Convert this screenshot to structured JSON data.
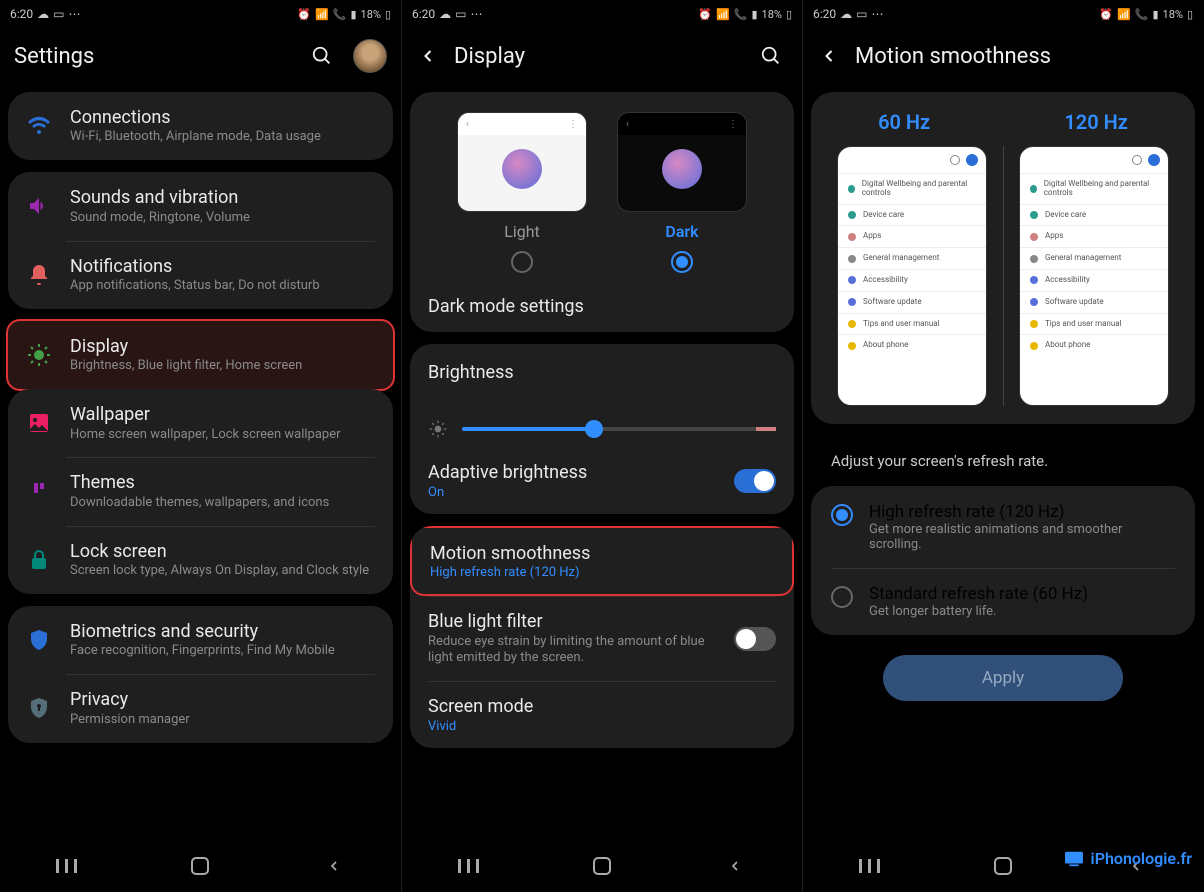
{
  "status": {
    "time": "6:20",
    "battery": "18%"
  },
  "panel1": {
    "title": "Settings",
    "groups": [
      {
        "items": [
          {
            "icon": "wifi",
            "label": "Connections",
            "sub": "Wi-Fi, Bluetooth, Airplane mode, Data usage"
          }
        ]
      },
      {
        "items": [
          {
            "icon": "sound",
            "label": "Sounds and vibration",
            "sub": "Sound mode, Ringtone, Volume"
          },
          {
            "icon": "bell",
            "label": "Notifications",
            "sub": "App notifications, Status bar, Do not disturb"
          }
        ]
      },
      {
        "highlight": true,
        "items": [
          {
            "icon": "brightness",
            "label": "Display",
            "sub": "Brightness, Blue light filter, Home screen"
          }
        ]
      },
      {
        "items": [
          {
            "icon": "image",
            "label": "Wallpaper",
            "sub": "Home screen wallpaper, Lock screen wallpaper"
          },
          {
            "icon": "palette",
            "label": "Themes",
            "sub": "Downloadable themes, wallpapers, and icons"
          },
          {
            "icon": "lock",
            "label": "Lock screen",
            "sub": "Screen lock type, Always On Display, and Clock style"
          }
        ]
      },
      {
        "items": [
          {
            "icon": "shield",
            "label": "Biometrics and security",
            "sub": "Face recognition, Fingerprints, Find My Mobile"
          },
          {
            "icon": "privacy",
            "label": "Privacy",
            "sub": "Permission manager"
          }
        ]
      }
    ]
  },
  "panel2": {
    "title": "Display",
    "theme": {
      "light": "Light",
      "dark": "Dark",
      "selected": "dark"
    },
    "dark_mode": "Dark mode settings",
    "brightness": {
      "label": "Brightness",
      "value": 42
    },
    "adaptive": {
      "label": "Adaptive brightness",
      "sub": "On",
      "on": true
    },
    "motion": {
      "label": "Motion smoothness",
      "sub": "High refresh rate (120 Hz)"
    },
    "bluefilter": {
      "label": "Blue light filter",
      "sub": "Reduce eye strain by limiting the amount of blue light emitted by the screen.",
      "on": false
    },
    "screenmode": {
      "label": "Screen mode",
      "sub": "Vivid"
    }
  },
  "panel3": {
    "title": "Motion smoothness",
    "hz": {
      "left": "60 Hz",
      "right": "120 Hz"
    },
    "preview_rows": [
      {
        "c": "#2a9d8f",
        "t": "Digital Wellbeing and parental controls"
      },
      {
        "c": "#2a9d8f",
        "t": "Device care"
      },
      {
        "c": "#d08080",
        "t": "Apps"
      },
      {
        "c": "#888",
        "t": "General management"
      },
      {
        "c": "#5a6ed8",
        "t": "Accessibility"
      },
      {
        "c": "#5a6ed8",
        "t": "Software update"
      },
      {
        "c": "#e6b800",
        "t": "Tips and user manual"
      },
      {
        "c": "#e6b800",
        "t": "About phone"
      }
    ],
    "desc": "Adjust your screen's refresh rate.",
    "options": [
      {
        "label": "High refresh rate (120 Hz)",
        "sub": "Get more realistic animations and smoother scrolling.",
        "selected": true
      },
      {
        "label": "Standard refresh rate (60 Hz)",
        "sub": "Get longer battery life.",
        "selected": false
      }
    ],
    "apply": "Apply"
  },
  "watermark": "iPhonologie.fr"
}
